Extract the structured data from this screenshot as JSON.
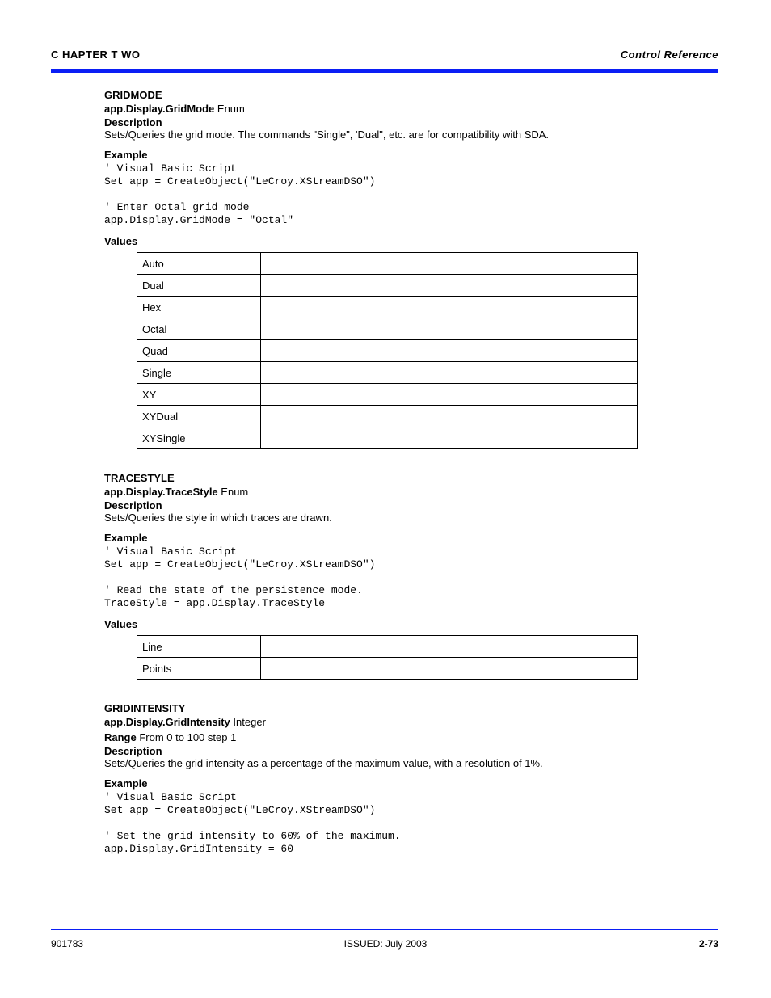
{
  "header": {
    "left": "C HAPTER T WO",
    "right_italic": "Control Reference"
  },
  "section1": {
    "heading": "GRIDMODE",
    "typeline_prefix": "app.Display.GridMode",
    "typeline_suffix": "Enum",
    "description": "Sets/Queries the grid mode. The commands \"Single\", 'Dual\", etc. are for compatibility with SDA.",
    "example_label": "Example",
    "code": "' Visual Basic Script\nSet app = CreateObject(\"LeCroy.XStreamDSO\")\n\n' Enter Octal grid mode\napp.Display.GridMode = \"Octal\"",
    "values_label": "Values",
    "values": [
      {
        "k": "Auto",
        "v": ""
      },
      {
        "k": "Dual",
        "v": ""
      },
      {
        "k": "Hex",
        "v": ""
      },
      {
        "k": "Octal",
        "v": ""
      },
      {
        "k": "Quad",
        "v": ""
      },
      {
        "k": "Single",
        "v": ""
      },
      {
        "k": "XY",
        "v": ""
      },
      {
        "k": "XYDual",
        "v": ""
      },
      {
        "k": "XYSingle",
        "v": ""
      }
    ]
  },
  "section2": {
    "heading": "TRACESTYLE",
    "typeline_prefix": "app.Display.TraceStyle",
    "typeline_suffix": "Enum",
    "description": "Sets/Queries the style in which traces are drawn.",
    "example_label": "Example",
    "code": "' Visual Basic Script\nSet app = CreateObject(\"LeCroy.XStreamDSO\")\n\n' Read the state of the persistence mode.\nTraceStyle = app.Display.TraceStyle",
    "values_label": "Values",
    "values": [
      {
        "k": "Line",
        "v": ""
      },
      {
        "k": "Points",
        "v": ""
      }
    ]
  },
  "section3": {
    "heading": "GRIDINTENSITY",
    "typeline_prefix": "app.Display.GridIntensity",
    "typeline_suffix": "Integer",
    "range_label": "Range",
    "range_value": "From 0 to 100 step 1",
    "description": "Sets/Queries the grid intensity as a percentage of the maximum value, with a resolution of 1%.",
    "example_label": "Example",
    "code": "' Visual Basic Script\nSet app = CreateObject(\"LeCroy.XStreamDSO\")\n\n' Set the grid intensity to 60% of the maximum.\napp.Display.GridIntensity = 60"
  },
  "footer": {
    "left": "901783",
    "center": "ISSUED: July 2003",
    "right": "2-73"
  }
}
